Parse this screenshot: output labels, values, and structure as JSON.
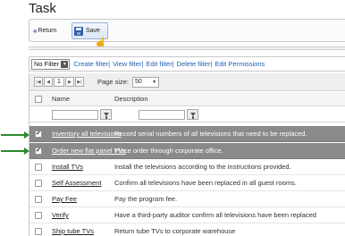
{
  "page": {
    "title": "Task"
  },
  "toolbar": {
    "return_label": "Return",
    "save_label": "Save"
  },
  "filterbar": {
    "selected_filter": "No Filter",
    "links": [
      "Create filter",
      "View filter",
      "Edit filter",
      "Delete filter",
      "Edit Permissions"
    ]
  },
  "pager": {
    "current_page": "1",
    "page_size_label": "Page size:",
    "page_size": "50"
  },
  "columns": {
    "name": "Name",
    "description": "Description"
  },
  "rows": [
    {
      "name": "Inventory all televisions",
      "description": "Record serial numbers of all televisions that need to be replaced.",
      "selected": true
    },
    {
      "name": "Order new flat panel TVs",
      "description": "Place order through corporate office.",
      "selected": true
    },
    {
      "name": "Install TVs",
      "description": "Install the televisions according to the instructions provided.",
      "selected": false
    },
    {
      "name": "Self Assessment",
      "description": "Confirm all televisions have been replaced in all guest rooms.",
      "selected": false
    },
    {
      "name": "Pay Fee",
      "description": "Pay the program fee.",
      "selected": false
    },
    {
      "name": "Verify",
      "description": "Have a third-party auditor confirm all televisions have been replaced",
      "selected": false
    },
    {
      "name": "Ship tube TVs",
      "description": "Return tube TVs to corporate warehouse",
      "selected": false
    }
  ],
  "colors": {
    "selected_row": "#8a8a8a",
    "link": "#1c5fb5",
    "arrow": "#2d8a2d"
  }
}
